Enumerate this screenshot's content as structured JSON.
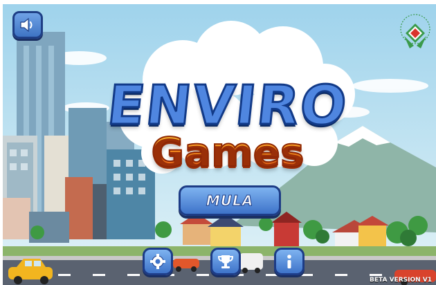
{
  "title": {
    "main": "ENVIRO",
    "sub": "Games"
  },
  "buttons": {
    "start_label": "MULA"
  },
  "footer": {
    "version": "BETA VERSION V1"
  },
  "icons": {
    "sound": "speaker-icon",
    "settings": "gear-icon",
    "trophy": "trophy-icon",
    "info": "info-icon",
    "logo": "environment-logo-badge"
  },
  "colors": {
    "sky": "#bfe3f2",
    "button_blue": "#4f86e0",
    "button_border": "#1d3c86",
    "title_blue": "#4f86e0",
    "title_orange": "#f0682a",
    "road": "#5a6270"
  }
}
